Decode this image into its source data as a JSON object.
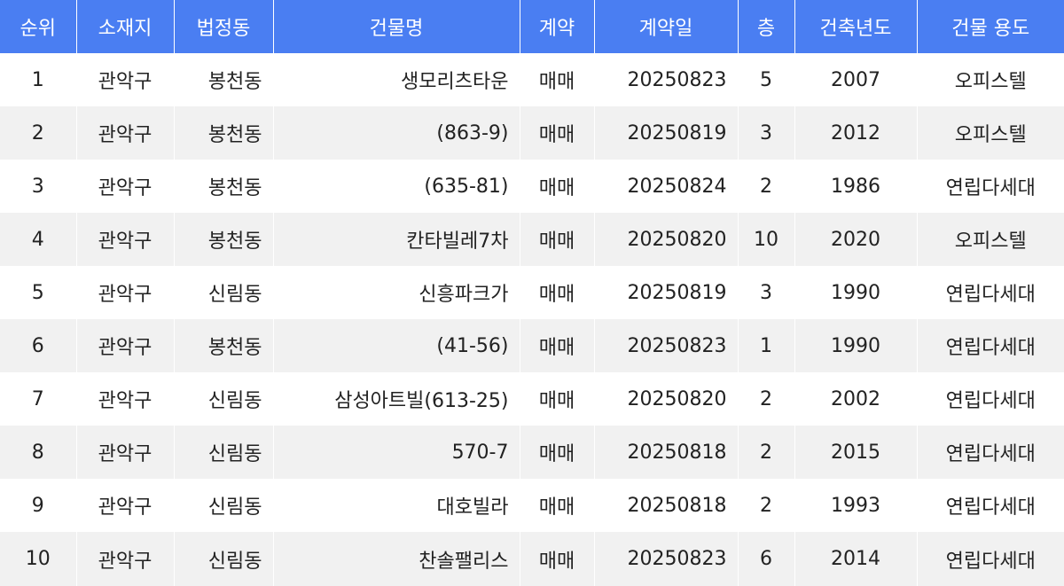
{
  "columns": [
    "순위",
    "소재지",
    "법정동",
    "건물명",
    "계약",
    "계약일",
    "층",
    "건축년도",
    "건물 용도"
  ],
  "rows": [
    {
      "rank": "1",
      "district": "관악구",
      "dong": "봉천동",
      "building": "생모리츠타운",
      "contract": "매매",
      "date": "20250823",
      "floor": "5",
      "year": "2007",
      "use": "오피스텔"
    },
    {
      "rank": "2",
      "district": "관악구",
      "dong": "봉천동",
      "building": "(863-9)",
      "contract": "매매",
      "date": "20250819",
      "floor": "3",
      "year": "2012",
      "use": "오피스텔"
    },
    {
      "rank": "3",
      "district": "관악구",
      "dong": "봉천동",
      "building": "(635-81)",
      "contract": "매매",
      "date": "20250824",
      "floor": "2",
      "year": "1986",
      "use": "연립다세대"
    },
    {
      "rank": "4",
      "district": "관악구",
      "dong": "봉천동",
      "building": "칸타빌레7차",
      "contract": "매매",
      "date": "20250820",
      "floor": "10",
      "year": "2020",
      "use": "오피스텔"
    },
    {
      "rank": "5",
      "district": "관악구",
      "dong": "신림동",
      "building": "신흥파크가",
      "contract": "매매",
      "date": "20250819",
      "floor": "3",
      "year": "1990",
      "use": "연립다세대"
    },
    {
      "rank": "6",
      "district": "관악구",
      "dong": "봉천동",
      "building": "(41-56)",
      "contract": "매매",
      "date": "20250823",
      "floor": "1",
      "year": "1990",
      "use": "연립다세대"
    },
    {
      "rank": "7",
      "district": "관악구",
      "dong": "신림동",
      "building": "삼성아트빌(613-25)",
      "contract": "매매",
      "date": "20250820",
      "floor": "2",
      "year": "2002",
      "use": "연립다세대"
    },
    {
      "rank": "8",
      "district": "관악구",
      "dong": "신림동",
      "building": "570-7",
      "contract": "매매",
      "date": "20250818",
      "floor": "2",
      "year": "2015",
      "use": "연립다세대"
    },
    {
      "rank": "9",
      "district": "관악구",
      "dong": "신림동",
      "building": "대호빌라",
      "contract": "매매",
      "date": "20250818",
      "floor": "2",
      "year": "1993",
      "use": "연립다세대"
    },
    {
      "rank": "10",
      "district": "관악구",
      "dong": "신림동",
      "building": "찬솔팰리스",
      "contract": "매매",
      "date": "20250823",
      "floor": "6",
      "year": "2014",
      "use": "연립다세대"
    }
  ]
}
